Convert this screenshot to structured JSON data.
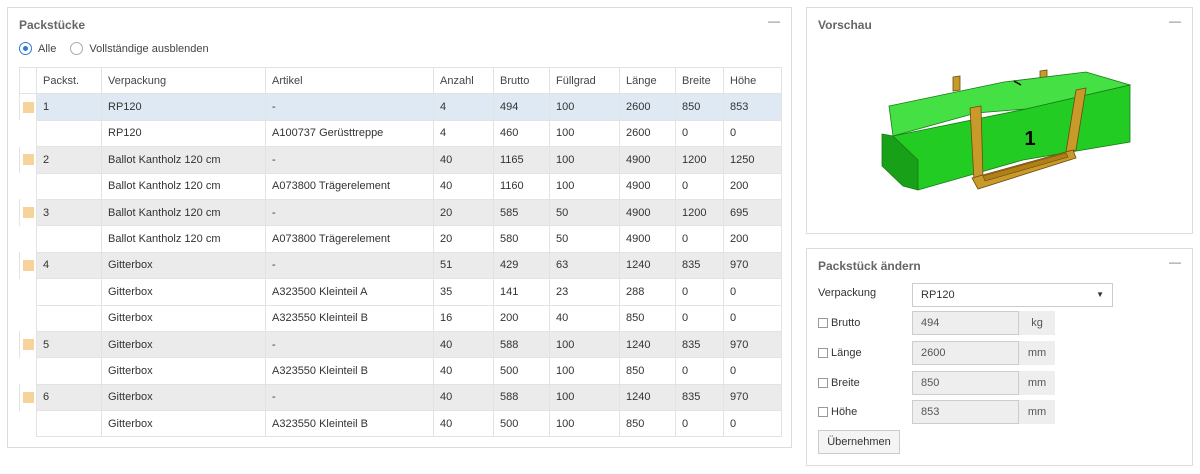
{
  "packstuecke": {
    "title": "Packstücke",
    "collapse_glyph": "—",
    "filter": {
      "options": [
        "Alle",
        "Vollständige ausblenden"
      ],
      "selected": "Alle"
    },
    "columns": [
      "Packst.",
      "Verpackung",
      "Artikel",
      "Anzahl",
      "Brutto",
      "Füllgrad",
      "Länge",
      "Breite",
      "Höhe"
    ],
    "rows": [
      {
        "type": "parent",
        "selected": true,
        "cells": [
          "1",
          "RP120",
          "-",
          "4",
          "494",
          "100",
          "2600",
          "850",
          "853"
        ]
      },
      {
        "type": "child",
        "cells": [
          "",
          "RP120",
          "A100737 Gerüsttreppe",
          "4",
          "460",
          "100",
          "2600",
          "0",
          "0"
        ]
      },
      {
        "type": "parent",
        "cells": [
          "2",
          "Ballot Kantholz 120 cm",
          "-",
          "40",
          "1165",
          "100",
          "4900",
          "1200",
          "1250"
        ]
      },
      {
        "type": "child",
        "cells": [
          "",
          "Ballot Kantholz 120 cm",
          "A073800 Trägerelement",
          "40",
          "1160",
          "100",
          "4900",
          "0",
          "200"
        ]
      },
      {
        "type": "parent",
        "cells": [
          "3",
          "Ballot Kantholz 120 cm",
          "-",
          "20",
          "585",
          "50",
          "4900",
          "1200",
          "695"
        ]
      },
      {
        "type": "child",
        "cells": [
          "",
          "Ballot Kantholz 120 cm",
          "A073800 Trägerelement",
          "20",
          "580",
          "50",
          "4900",
          "0",
          "200"
        ]
      },
      {
        "type": "parent",
        "cells": [
          "4",
          "Gitterbox",
          "-",
          "51",
          "429",
          "63",
          "1240",
          "835",
          "970"
        ]
      },
      {
        "type": "child",
        "cells": [
          "",
          "Gitterbox",
          "A323500 Kleinteil A",
          "35",
          "141",
          "23",
          "288",
          "0",
          "0"
        ]
      },
      {
        "type": "child",
        "cells": [
          "",
          "Gitterbox",
          "A323550 Kleinteil B",
          "16",
          "200",
          "40",
          "850",
          "0",
          "0"
        ]
      },
      {
        "type": "parent",
        "cells": [
          "5",
          "Gitterbox",
          "-",
          "40",
          "588",
          "100",
          "1240",
          "835",
          "970"
        ]
      },
      {
        "type": "child",
        "cells": [
          "",
          "Gitterbox",
          "A323550 Kleinteil B",
          "40",
          "500",
          "100",
          "850",
          "0",
          "0"
        ]
      },
      {
        "type": "parent",
        "cells": [
          "6",
          "Gitterbox",
          "-",
          "40",
          "588",
          "100",
          "1240",
          "835",
          "970"
        ]
      },
      {
        "type": "child",
        "cells": [
          "",
          "Gitterbox",
          "A323550 Kleinteil B",
          "40",
          "500",
          "100",
          "850",
          "0",
          "0"
        ]
      }
    ],
    "marker_color": "#f6d39a",
    "selected_row_color": "#dfe9f3"
  },
  "vorschau": {
    "title": "Vorschau",
    "collapse_glyph": "—",
    "box_label": "1",
    "box_color": "#22cc22",
    "pallet_color": "#c89a2a"
  },
  "aendern": {
    "title": "Packstück ändern",
    "collapse_glyph": "—",
    "verpackung_label": "Verpackung",
    "verpackung_value": "RP120",
    "fields": [
      {
        "label": "Brutto",
        "value": "494",
        "unit": "kg"
      },
      {
        "label": "Länge",
        "value": "2600",
        "unit": "mm"
      },
      {
        "label": "Breite",
        "value": "850",
        "unit": "mm"
      },
      {
        "label": "Höhe",
        "value": "853",
        "unit": "mm"
      }
    ],
    "apply_button": "Übernehmen"
  }
}
